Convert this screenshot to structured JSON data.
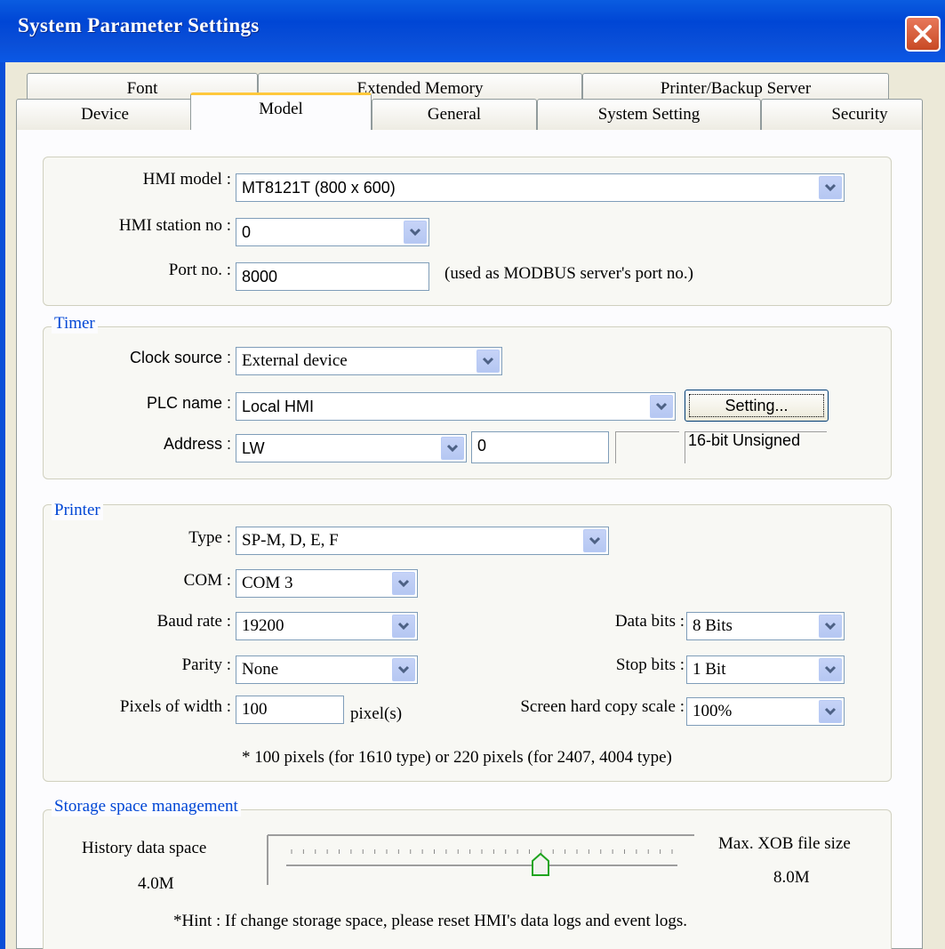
{
  "window": {
    "title": "System Parameter Settings"
  },
  "tabs_back": [
    "Font",
    "Extended Memory",
    "Printer/Backup Server"
  ],
  "tabs_front": [
    "Device",
    "Model",
    "General",
    "System Setting",
    "Security"
  ],
  "active_tab": "Model",
  "model": {
    "hmi_model_label": "HMI model :",
    "hmi_model_value": "MT8121T (800 x 600)",
    "station_label": "HMI station no :",
    "station_value": "0",
    "port_label": "Port no. :",
    "port_value": "8000",
    "port_note": "(used as MODBUS server's port no.)"
  },
  "timer": {
    "title": "Timer",
    "clock_label": "Clock source :",
    "clock_value": "External device",
    "plc_label": "PLC name :",
    "plc_value": "Local HMI",
    "setting_button": "Setting...",
    "address_label": "Address :",
    "address_device": "LW",
    "address_value": "0",
    "address_format": "16-bit Unsigned"
  },
  "printer": {
    "title": "Printer",
    "type_label": "Type :",
    "type_value": "SP-M, D, E, F",
    "com_label": "COM :",
    "com_value": "COM 3",
    "baud_label": "Baud rate :",
    "baud_value": "19200",
    "databits_label": "Data bits :",
    "databits_value": "8 Bits",
    "parity_label": "Parity :",
    "parity_value": "None",
    "stopbits_label": "Stop bits :",
    "stopbits_value": "1 Bit",
    "pixels_label": "Pixels of width :",
    "pixels_value": "100",
    "pixels_unit": "pixel(s)",
    "scale_label": "Screen hard copy scale :",
    "scale_value": "100%",
    "note": "* 100 pixels (for 1610 type) or 220 pixels (for 2407, 4004 type)"
  },
  "storage": {
    "title": "Storage space management",
    "history_label": "History data space",
    "history_value": "4.0M",
    "xob_label": "Max. XOB file size",
    "xob_value": "8.0M",
    "slider_fraction": 0.65,
    "hint": "*Hint : If change storage space, please reset HMI's data logs and event logs."
  },
  "icons": {
    "close": "close-icon",
    "dropdown": "chevron-down-icon"
  }
}
